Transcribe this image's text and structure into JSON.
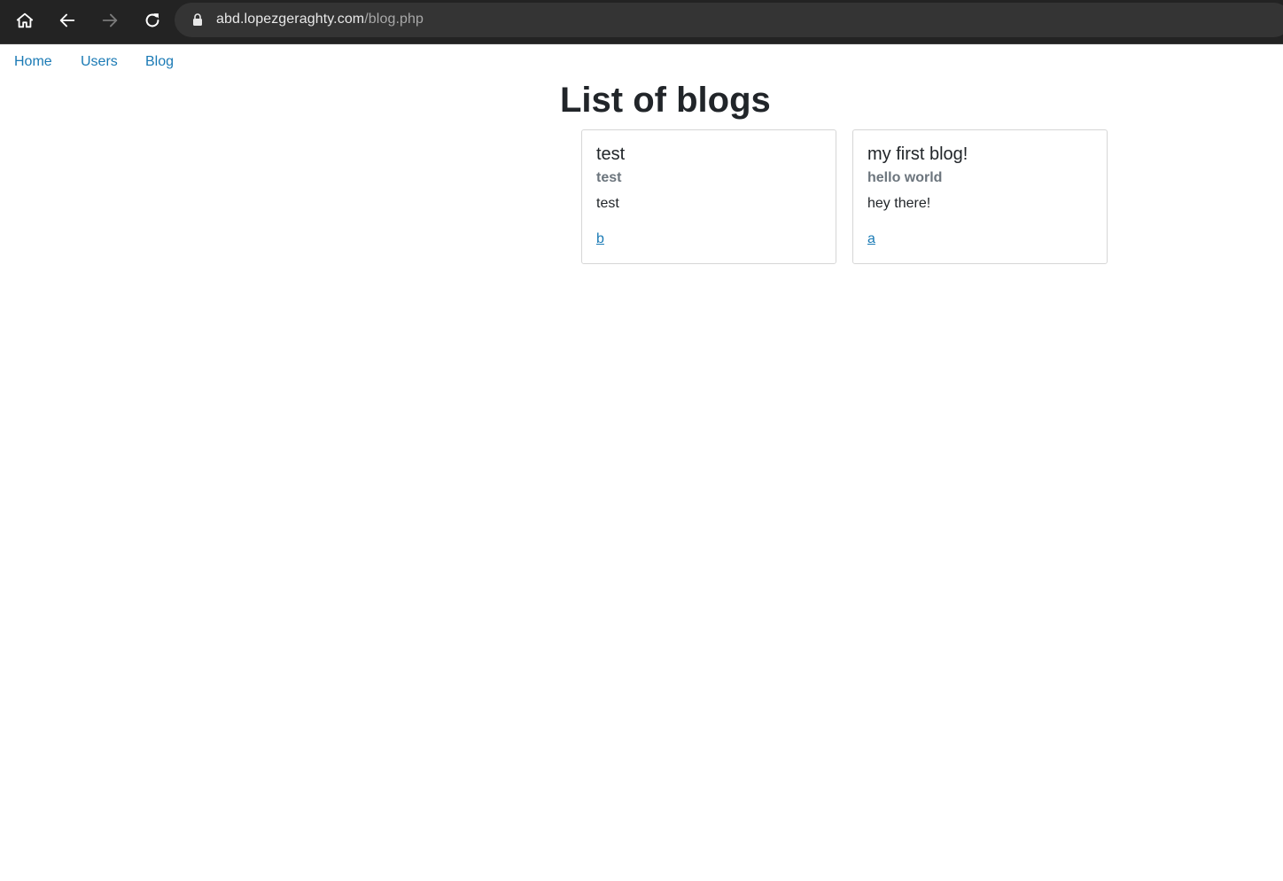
{
  "browser": {
    "url_host": "abd.lopezgeraghty.com",
    "url_path": "/blog.php",
    "icons": [
      "home-icon",
      "back-arrow-icon",
      "forward-arrow-icon",
      "reload-icon",
      "lock-icon"
    ]
  },
  "nav": {
    "items": [
      {
        "label": "Home"
      },
      {
        "label": "Users"
      },
      {
        "label": "Blog"
      }
    ]
  },
  "page": {
    "title": "List of blogs"
  },
  "blogs": [
    {
      "title": "test",
      "subtitle": "test",
      "text": "test",
      "link": "b"
    },
    {
      "title": "my first blog!",
      "subtitle": "hello world",
      "text": "hey there!",
      "link": "a"
    }
  ],
  "colors": {
    "link": "#1a7ab5",
    "browser_bg": "#232323",
    "address_bg": "#343434",
    "text": "#212529",
    "muted": "#6c757d"
  }
}
